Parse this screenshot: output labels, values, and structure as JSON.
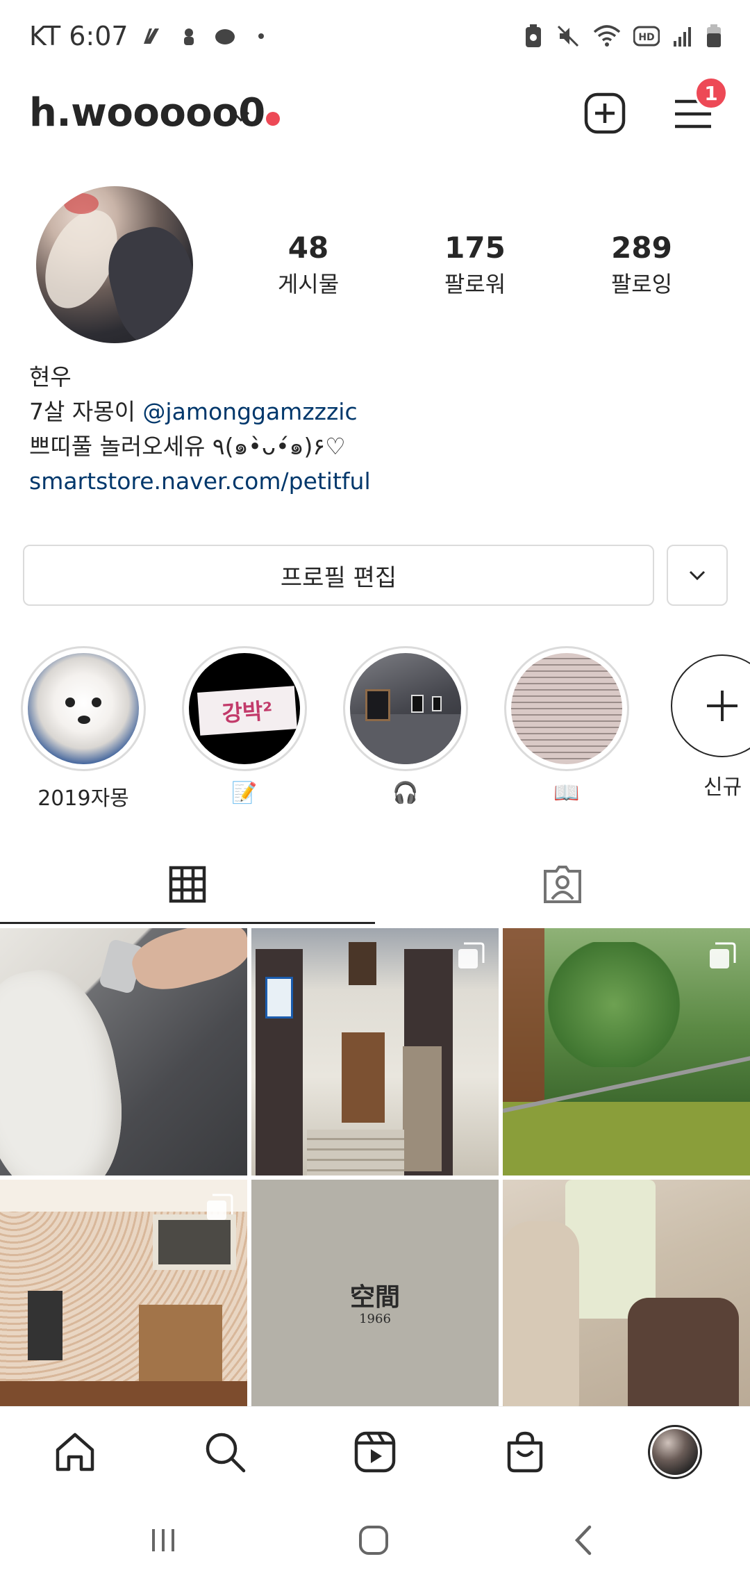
{
  "status_bar": {
    "carrier_time": "KT 6:07"
  },
  "header": {
    "username": "h.wooooo0",
    "notification_count": "1"
  },
  "profile": {
    "stats": [
      {
        "value": "48",
        "label": "게시물"
      },
      {
        "value": "175",
        "label": "팔로워"
      },
      {
        "value": "289",
        "label": "팔로잉"
      }
    ],
    "bio": {
      "name": "현우",
      "line2_prefix": "7살 자몽이 ",
      "line2_mention": "@jamonggamzzzic",
      "line3": "쁘띠풀 놀러오세유 ٩(๑•̀ᴗ•́๑)۶♡",
      "link": "smartstore.naver.com/petitful"
    }
  },
  "actions": {
    "edit_profile": "프로필 편집"
  },
  "highlights": [
    {
      "label": "2019자몽"
    },
    {
      "label": "📝"
    },
    {
      "label": "🎧"
    },
    {
      "label": "📖"
    },
    {
      "label": "신규"
    }
  ],
  "highlight_media_text": {
    "lecture_sign": "강박²"
  },
  "grid_media_text": {
    "sweatshirt_print": "空間",
    "sweatshirt_year": "1966"
  },
  "colors": {
    "link": "#00376b",
    "badge_red": "#ed4956",
    "border": "#dbdbdb"
  }
}
